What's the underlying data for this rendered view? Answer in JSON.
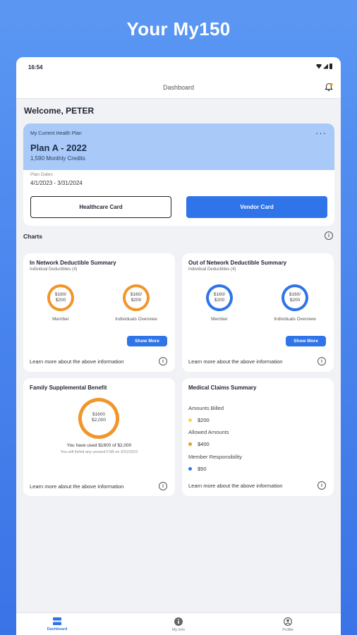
{
  "hero": {
    "title": "Your My150"
  },
  "status_bar": {
    "time": "16:54"
  },
  "app_bar": {
    "title": "Dashboard"
  },
  "welcome": "Welcome, PETER",
  "plan": {
    "kicker": "My Current Health Plan",
    "name": "Plan A - 2022",
    "credits": "1,590 Monthly Credits",
    "dates_label": "Plan Dates",
    "dates": "4/1/2023 - 3/31/2024",
    "more": "···",
    "healthcare_button": "Healthcare Card",
    "vendor_button": "Vendor Card"
  },
  "charts_label": "Charts",
  "in_network": {
    "title": "In Network Deductible Summary",
    "subtitle": "Individual Deductibles (4)",
    "ring1": {
      "line1": "$160/",
      "line2": "$200",
      "caption": "Member",
      "fraction": 0.8,
      "color": "#f0962b"
    },
    "ring2": {
      "line1": "$160/",
      "line2": "$200",
      "caption": "Individuals Overview",
      "fraction": 0.8,
      "color": "#f0962b"
    },
    "show_more": "Show More",
    "learn_more": "Learn more about the above information"
  },
  "out_network": {
    "title": "Out of Network Deductible Summary",
    "subtitle": "Individual Deductibles (4)",
    "ring1": {
      "line1": "$160/",
      "line2": "$200",
      "caption": "Member",
      "fraction": 0.8,
      "color": "#2f74e8"
    },
    "ring2": {
      "line1": "$160/",
      "line2": "$200",
      "caption": "Individuals Overview",
      "fraction": 0.8,
      "color": "#2f74e8"
    },
    "show_more": "Show More",
    "learn_more": "Learn more about the above information"
  },
  "family": {
    "title": "Family Supplemental Benefit",
    "ring": {
      "line1": "$1600",
      "line2": "$2,000",
      "fraction": 0.8,
      "color": "#f0962b"
    },
    "used_text": "You have used $1600 of $2,000",
    "forfeit_text": "You will forfeit any unused FSB on 3/31/2022",
    "learn_more": "Learn more about the above information"
  },
  "claims": {
    "title": "Medical Claims Summary",
    "items": [
      {
        "label": "Amounts Billed",
        "value": "$200",
        "color": "#f7d64a"
      },
      {
        "label": "Allowed Amounts",
        "value": "$400",
        "color": "#f0962b"
      },
      {
        "label": "Member Responsibility",
        "value": "$50",
        "color": "#2f74e8"
      }
    ],
    "learn_more": "Learn more about the above information"
  },
  "tabs": [
    {
      "label": "Dashboard",
      "icon": "dashboard-icon",
      "active": true
    },
    {
      "label": "My Info",
      "icon": "info-circle-icon",
      "active": false
    },
    {
      "label": "Profile",
      "icon": "person-icon",
      "active": false
    }
  ],
  "colors": {
    "accent": "#2f74e8",
    "orange": "#f0962b",
    "yellow": "#f7d64a",
    "plan_header": "#a9c9f8"
  }
}
